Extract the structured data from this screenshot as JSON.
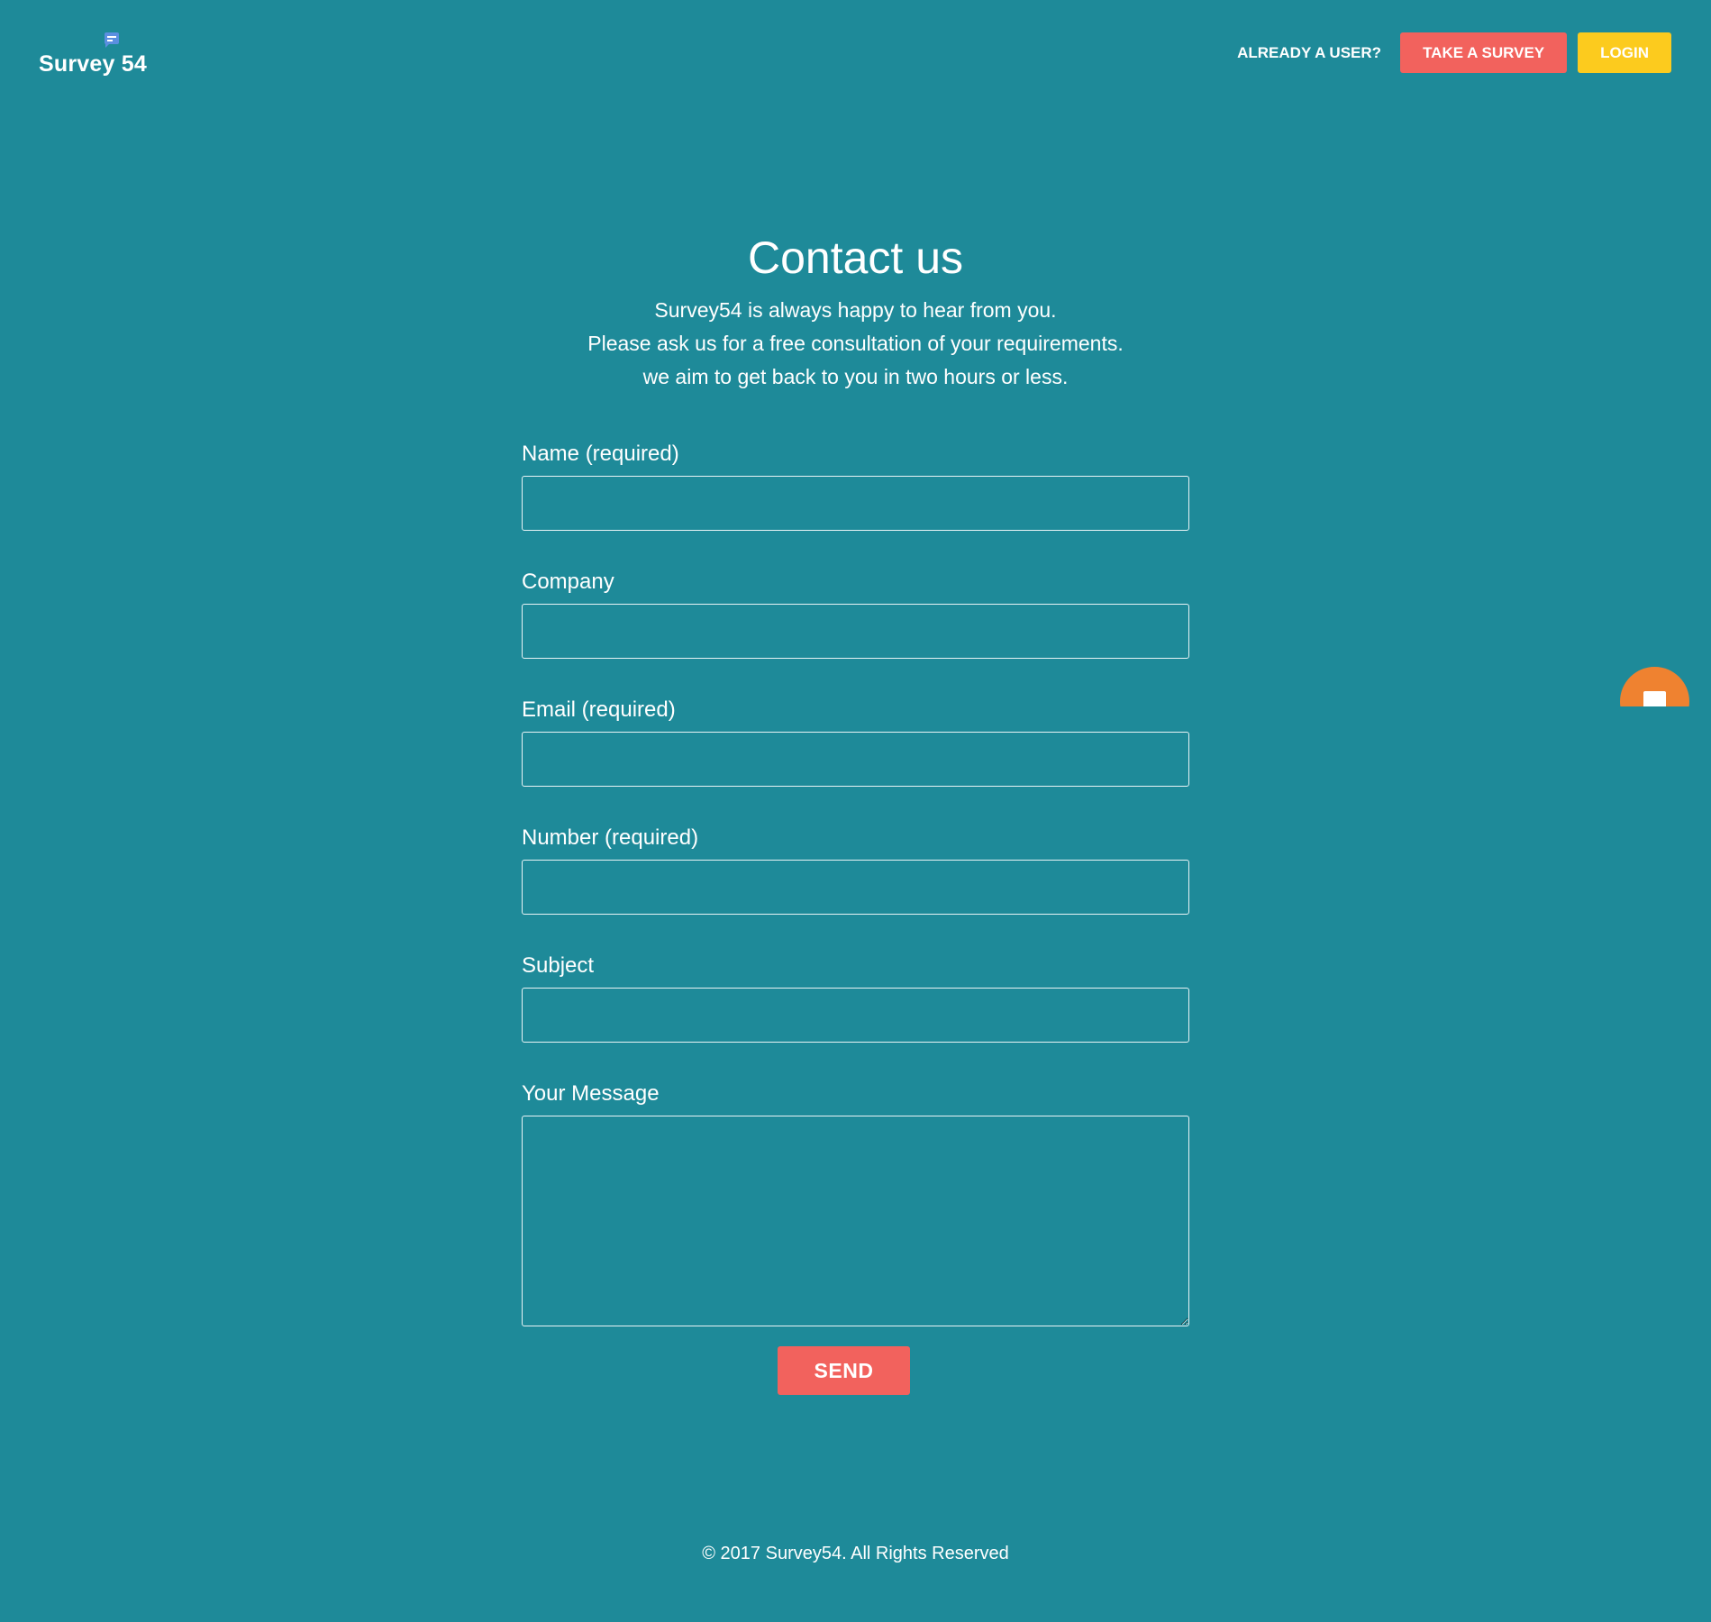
{
  "brand": {
    "logo_text": "Survey 54",
    "logo_icon": "chat-bubble-icon"
  },
  "nav": {
    "already_user_text": "ALREADY A USER?",
    "take_survey_label": "TAKE A SURVEY",
    "login_label": "LOGIN"
  },
  "main": {
    "title": "Contact us",
    "intro_lines": [
      "Survey54 is always happy to hear from you.",
      "Please ask us for a free consultation of your requirements.",
      "we aim to get back to you in two hours or less."
    ]
  },
  "form": {
    "fields": [
      {
        "label": "Name (required)",
        "value": ""
      },
      {
        "label": "Company",
        "value": ""
      },
      {
        "label": "Email (required)",
        "value": ""
      },
      {
        "label": "Number (required)",
        "value": ""
      },
      {
        "label": "Subject",
        "value": ""
      }
    ],
    "message": {
      "label": "Your Message",
      "value": ""
    },
    "send_label": "SEND"
  },
  "chat_widget": {
    "icon": "chat-icon"
  },
  "footer": {
    "copyright": "© 2017 Survey54. All Rights Reserved"
  },
  "colors": {
    "background": "#1e8a99",
    "primary_button": "#f2625d",
    "login_button": "#fccb1e",
    "chat_widget": "#ef8230",
    "logo_icon": "#5b8fe0"
  }
}
